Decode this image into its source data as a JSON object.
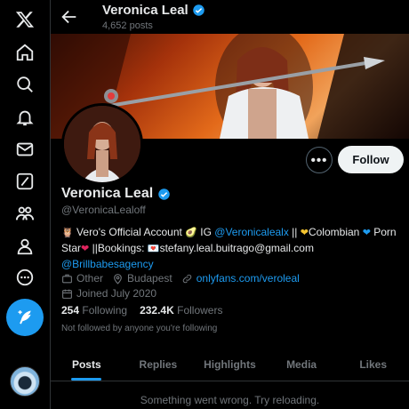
{
  "nav": {
    "items": [
      {
        "name": "x-logo-icon"
      },
      {
        "name": "home-icon"
      },
      {
        "name": "search-icon"
      },
      {
        "name": "notifications-icon"
      },
      {
        "name": "messages-icon"
      },
      {
        "name": "grok-icon"
      },
      {
        "name": "communities-icon"
      },
      {
        "name": "profile-icon"
      },
      {
        "name": "more-icon"
      }
    ],
    "compose_icon": "feather-plus-icon"
  },
  "header": {
    "name": "Veronica Leal",
    "post_count": "4,652 posts"
  },
  "profile": {
    "name": "Veronica Leal",
    "handle": "@VeronicaLealoff",
    "more_label": "•••",
    "follow_label": "Follow",
    "bio": {
      "p1": "Vero's Official Account",
      "p2": "IG",
      "ig_link": "@Veronicalealx",
      "p3": "||",
      "p4": "Colombian",
      "p5": "Porn Star",
      "p6": "||Bookings:",
      "p7": "stefany.leal.buitrago@gmail.com",
      "agency_link": "@Brillbabesagency"
    },
    "category": "Other",
    "location": "Budapest",
    "website": "onlyfans.com/veroleal",
    "joined": "Joined July 2020",
    "following_count": "254",
    "following_label": "Following",
    "followers_count": "232.4K",
    "followers_label": "Followers",
    "not_followed": "Not followed by anyone you're following"
  },
  "tabs": [
    {
      "label": "Posts",
      "active": true
    },
    {
      "label": "Replies",
      "active": false
    },
    {
      "label": "Highlights",
      "active": false
    },
    {
      "label": "Media",
      "active": false
    },
    {
      "label": "Likes",
      "active": false
    }
  ],
  "error_message": "Something went wrong. Try reloading.",
  "colors": {
    "accent": "#1d9bf0",
    "background": "#000000",
    "muted": "#71767b"
  }
}
